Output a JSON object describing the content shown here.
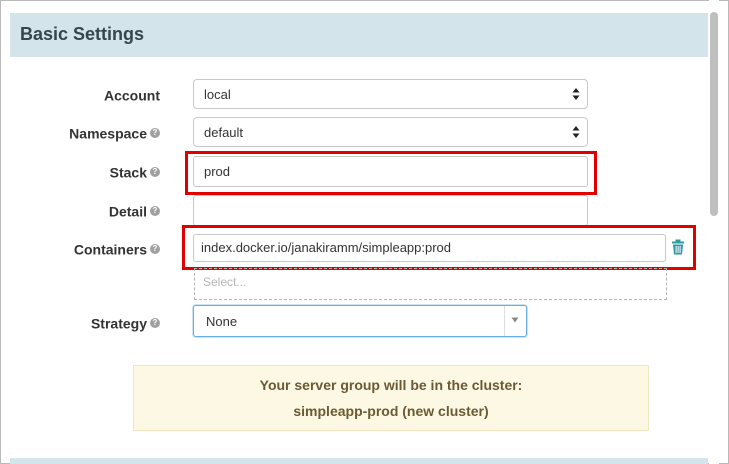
{
  "panel": {
    "title": "Basic Settings"
  },
  "form": {
    "account": {
      "label": "Account",
      "value": "local"
    },
    "namespace": {
      "label": "Namespace",
      "value": "default"
    },
    "stack": {
      "label": "Stack",
      "value": "prod"
    },
    "detail": {
      "label": "Detail",
      "value": ""
    },
    "containers": {
      "label": "Containers",
      "value": "index.docker.io/janakiramm/simpleapp:prod",
      "placeholder": "Select..."
    },
    "strategy": {
      "label": "Strategy",
      "value": "None"
    }
  },
  "info": {
    "line1": "Your server group will be in the cluster:",
    "line2": "simpleapp-prod (new cluster)"
  },
  "colors": {
    "header_bg": "#d3e4ea",
    "highlight": "#e10000",
    "trash": "#2f9aa3",
    "info_bg": "#fcf8e3"
  },
  "icons": [
    "help-icon",
    "trash-icon",
    "select-arrows-icon",
    "chevron-down-icon"
  ]
}
